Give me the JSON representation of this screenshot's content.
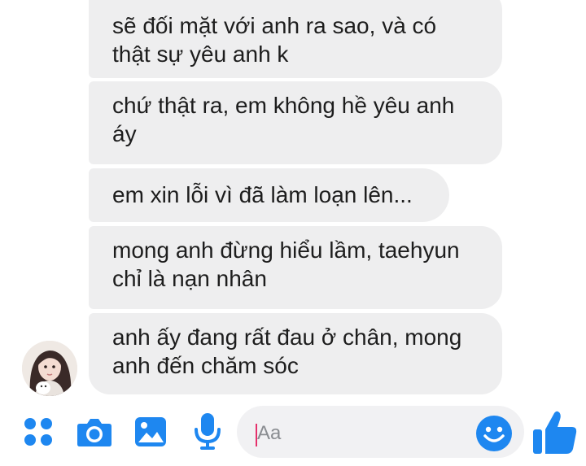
{
  "messages": [
    {
      "lines": [
        "sẽ đối mặt với anh ra sao, và có",
        "thật sự yêu anh k"
      ]
    },
    {
      "lines": [
        "chứ thật ra, em không hề yêu anh",
        "áy"
      ]
    },
    {
      "lines": [
        "em xin lỗi vì đã làm loạn lên..."
      ]
    },
    {
      "lines": [
        "mong anh đừng hiểu lầm, taehyun",
        "chỉ là nạn nhân"
      ]
    },
    {
      "lines": [
        "anh ấy đang rất đau ở chân, mong",
        "anh đến chăm sóc"
      ]
    }
  ],
  "composer": {
    "placeholder": "Aa",
    "tools": [
      "more-icon",
      "camera-icon",
      "image-icon",
      "microphone-icon"
    ],
    "emoji_icon": "smile-icon",
    "send_icon": "thumbs-up-icon"
  },
  "colors": {
    "accent": "#1e87f0",
    "bubble": "#eeeeef",
    "input_bg": "#f1f1f3",
    "caret": "#e5306b"
  }
}
